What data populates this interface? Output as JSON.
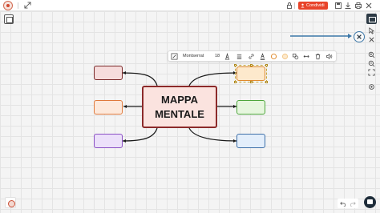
{
  "toolbar": {
    "share_label": "Condividi"
  },
  "format_toolbar": {
    "font_name": "Montserrat",
    "font_size": "18"
  },
  "mind_map": {
    "central_line1": "MAPPA",
    "central_line2": "MENTALE",
    "central_fill": "#fbe3df",
    "central_border": "#8c2a2a",
    "nodes": [
      {
        "side": "left",
        "fill": "#f6dcdc",
        "border": "#7a2828"
      },
      {
        "side": "left",
        "fill": "#fde9dc",
        "border": "#e07a3c"
      },
      {
        "side": "left",
        "fill": "#ece0fa",
        "border": "#8a4fc4"
      },
      {
        "side": "right",
        "fill": "#fde9cc",
        "border": "#e08a2c",
        "selected": true
      },
      {
        "side": "right",
        "fill": "#e6f6de",
        "border": "#4ea63c"
      },
      {
        "side": "right",
        "fill": "#e3eefb",
        "border": "#3d6fa8"
      }
    ]
  },
  "colors": {
    "share_button": "#e8442a",
    "annotation": "#3d78a8",
    "dark_button": "#2d3a45"
  }
}
